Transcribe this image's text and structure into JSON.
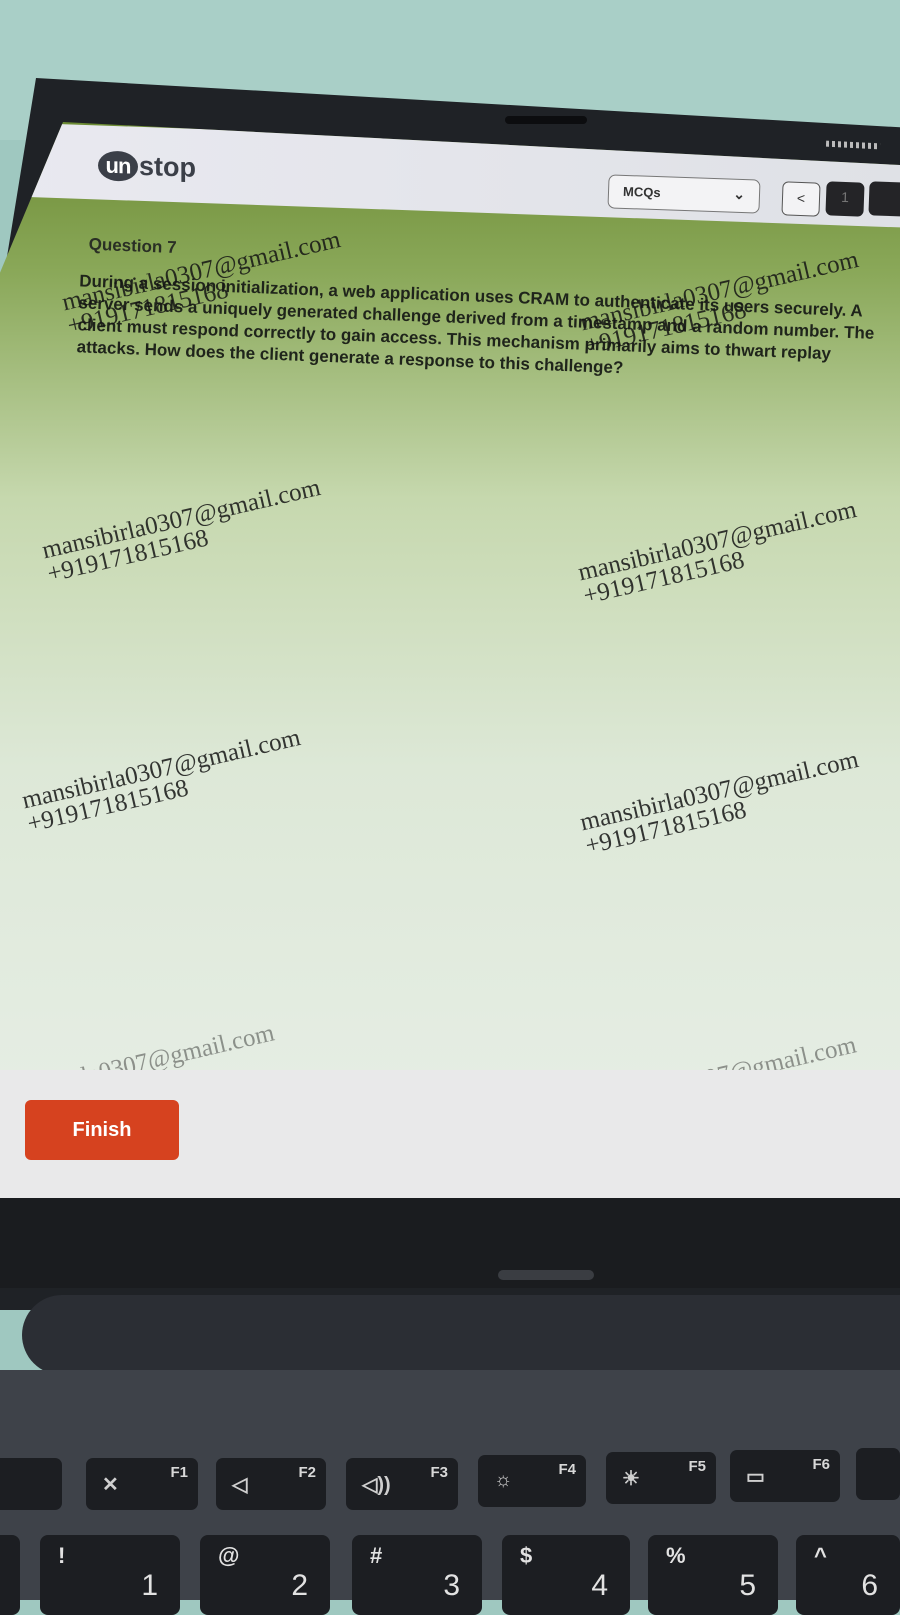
{
  "header": {
    "logo_badge": "un",
    "logo_rest": "stop",
    "section_select": "MCQs",
    "prev_glyph": "<",
    "question_nav_number": "1"
  },
  "question": {
    "label": "Question 7",
    "text": "During a session initialization, a web application uses CRAM to authenticate its users securely. A server sends a uniquely generated challenge derived from a timestamp and a random number. The client must respond correctly to gain access. This mechanism primarily aims to thwart replay attacks. How does the client generate a response to this challenge?"
  },
  "watermark": {
    "email": "mansibirla0307@gmail.com",
    "phone": "+919171815168",
    "partial_email": "birla0307@gmail.com",
    "partial_phone": "168"
  },
  "footer": {
    "finish_label": "Finish"
  },
  "keyboard": {
    "function_keys": [
      {
        "label": "F1",
        "icon": "mic-mute-icon",
        "glyph": "✕"
      },
      {
        "label": "F2",
        "icon": "volume-down-icon",
        "glyph": "◁"
      },
      {
        "label": "F3",
        "icon": "volume-up-icon",
        "glyph": "◁))"
      },
      {
        "label": "F4",
        "icon": "brightness-down-icon",
        "glyph": "☼"
      },
      {
        "label": "F5",
        "icon": "brightness-up-icon",
        "glyph": "☀"
      },
      {
        "label": "F6",
        "icon": "display-icon",
        "glyph": "▭"
      }
    ],
    "number_keys": [
      {
        "top": "!",
        "bottom": "1"
      },
      {
        "top": "@",
        "bottom": "2"
      },
      {
        "top": "#",
        "bottom": "3"
      },
      {
        "top": "$",
        "bottom": "4"
      },
      {
        "top": "%",
        "bottom": "5"
      },
      {
        "top": "^",
        "bottom": "6"
      }
    ]
  },
  "colors": {
    "finish": "#d6421f",
    "screen_top": "#6c8b33",
    "bezel": "#1f2226"
  }
}
